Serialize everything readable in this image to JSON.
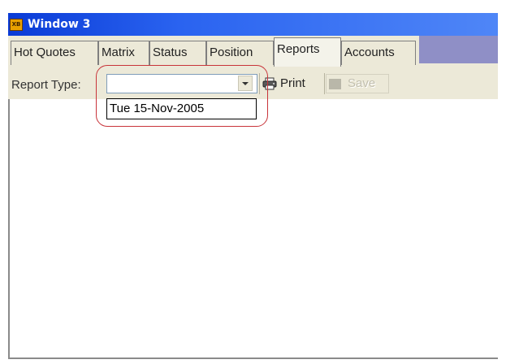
{
  "window": {
    "title": "Window 3",
    "icon": "app-logo-icon",
    "icon_text": "XB"
  },
  "tabs": [
    {
      "label": "Hot Quotes",
      "active": false
    },
    {
      "label": "Matrix",
      "active": false
    },
    {
      "label": "Status",
      "active": false
    },
    {
      "label": "Position",
      "active": false
    },
    {
      "label": "Reports",
      "active": true
    },
    {
      "label": "Accounts",
      "active": false
    }
  ],
  "toolbar": {
    "report_type_label": "Report Type:",
    "report_type_value": "",
    "dropdown_options": [
      "Tue 15-Nov-2005"
    ],
    "print_label": "Print",
    "save_label": "Save",
    "print_icon": "printer-icon",
    "save_icon": "disk-icon"
  },
  "colors": {
    "title_bar": "#0a3bd6",
    "tab_strip_fill": "#8f8fc6",
    "highlight_ring": "#c8343a",
    "disabled_text": "#c2bfae"
  }
}
